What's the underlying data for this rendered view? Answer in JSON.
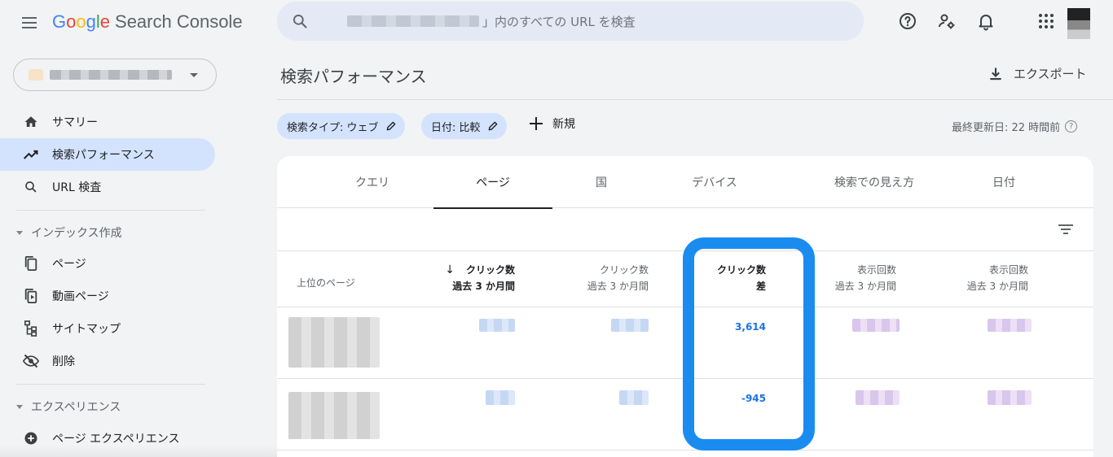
{
  "app": {
    "logo_letters": [
      "G",
      "o",
      "o",
      "g",
      "l",
      "e"
    ],
    "logo_rest": "Search Console"
  },
  "search": {
    "suffix_text": "」内のすべての URL を検査"
  },
  "icons": {
    "menu": "hamburger-menu-icon",
    "search": "search-icon",
    "help": "help-icon",
    "account-settings": "manage-accounts-icon",
    "notifications": "bell-icon",
    "apps": "apps-grid-icon"
  },
  "sidebar": {
    "items": [
      {
        "label": "サマリー",
        "icon": "home-icon"
      },
      {
        "label": "検索パフォーマンス",
        "icon": "trending-up-icon",
        "active": true
      },
      {
        "label": "URL 検査",
        "icon": "search-icon"
      }
    ],
    "index_section": {
      "title": "インデックス作成",
      "items": [
        {
          "label": "ページ",
          "icon": "file-copy-icon"
        },
        {
          "label": "動画ページ",
          "icon": "video-page-icon"
        },
        {
          "label": "サイトマップ",
          "icon": "sitemap-icon"
        },
        {
          "label": "削除",
          "icon": "visibility-off-icon"
        }
      ]
    },
    "experience_section": {
      "title": "エクスペリエンス",
      "items": [
        {
          "label": "ページ エクスペリエンス",
          "icon": "add-circle-icon"
        }
      ]
    }
  },
  "main": {
    "title": "検索パフォーマンス",
    "export_label": "エクスポート",
    "chips": [
      {
        "label": "検索タイプ: ウェブ"
      },
      {
        "label": "日付: 比較"
      }
    ],
    "new_label": "新規",
    "last_updated": "最終更新日: 22 時間前",
    "tabs": [
      "クエリ",
      "ページ",
      "国",
      "デバイス",
      "検索での見え方",
      "日付"
    ],
    "active_tab": "ページ",
    "table": {
      "headers": [
        {
          "line1": "上位のページ",
          "line2": ""
        },
        {
          "line1": "クリック数",
          "line2": "過去 3 か月間",
          "sorted": true
        },
        {
          "line1": "クリック数",
          "line2": "過去 3 か月間"
        },
        {
          "line1": "クリック数",
          "line2": "差"
        },
        {
          "line1": "表示回数",
          "line2": "過去 3 か月間"
        },
        {
          "line1": "表示回数",
          "line2": "過去 3 か月間"
        }
      ],
      "rows": [
        {
          "clicks_diff": "3,614"
        },
        {
          "clicks_diff": "-945"
        }
      ]
    },
    "colors": {
      "accent": "#1a73e8",
      "highlight_border": "#1a8cf0",
      "active_nav": "#d3e3fd"
    }
  }
}
